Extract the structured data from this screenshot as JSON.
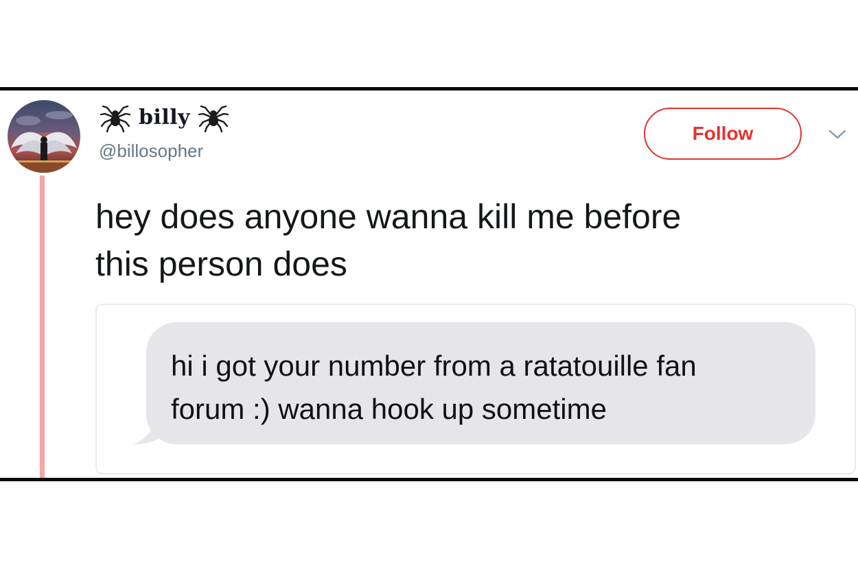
{
  "user": {
    "display_name": "billy",
    "handle": "@billosopher",
    "avatar_icon": "avatar-image",
    "name_decoration_icon": "spider-icon"
  },
  "actions": {
    "follow_label": "Follow",
    "menu_icon": "chevron-down-icon"
  },
  "tweet": {
    "text_line1": "hey does anyone wanna kill me before",
    "text_line2": "this person does"
  },
  "attached_image": {
    "message_line1": "hi i got your number from a ratatouille fan",
    "message_line2": "forum :) wanna hook up sometime"
  },
  "colors": {
    "follow_accent": "#e8312f",
    "thread_line": "#f5a5a5",
    "bubble_bg": "#e5e5ea",
    "handle_gray": "#657786"
  }
}
